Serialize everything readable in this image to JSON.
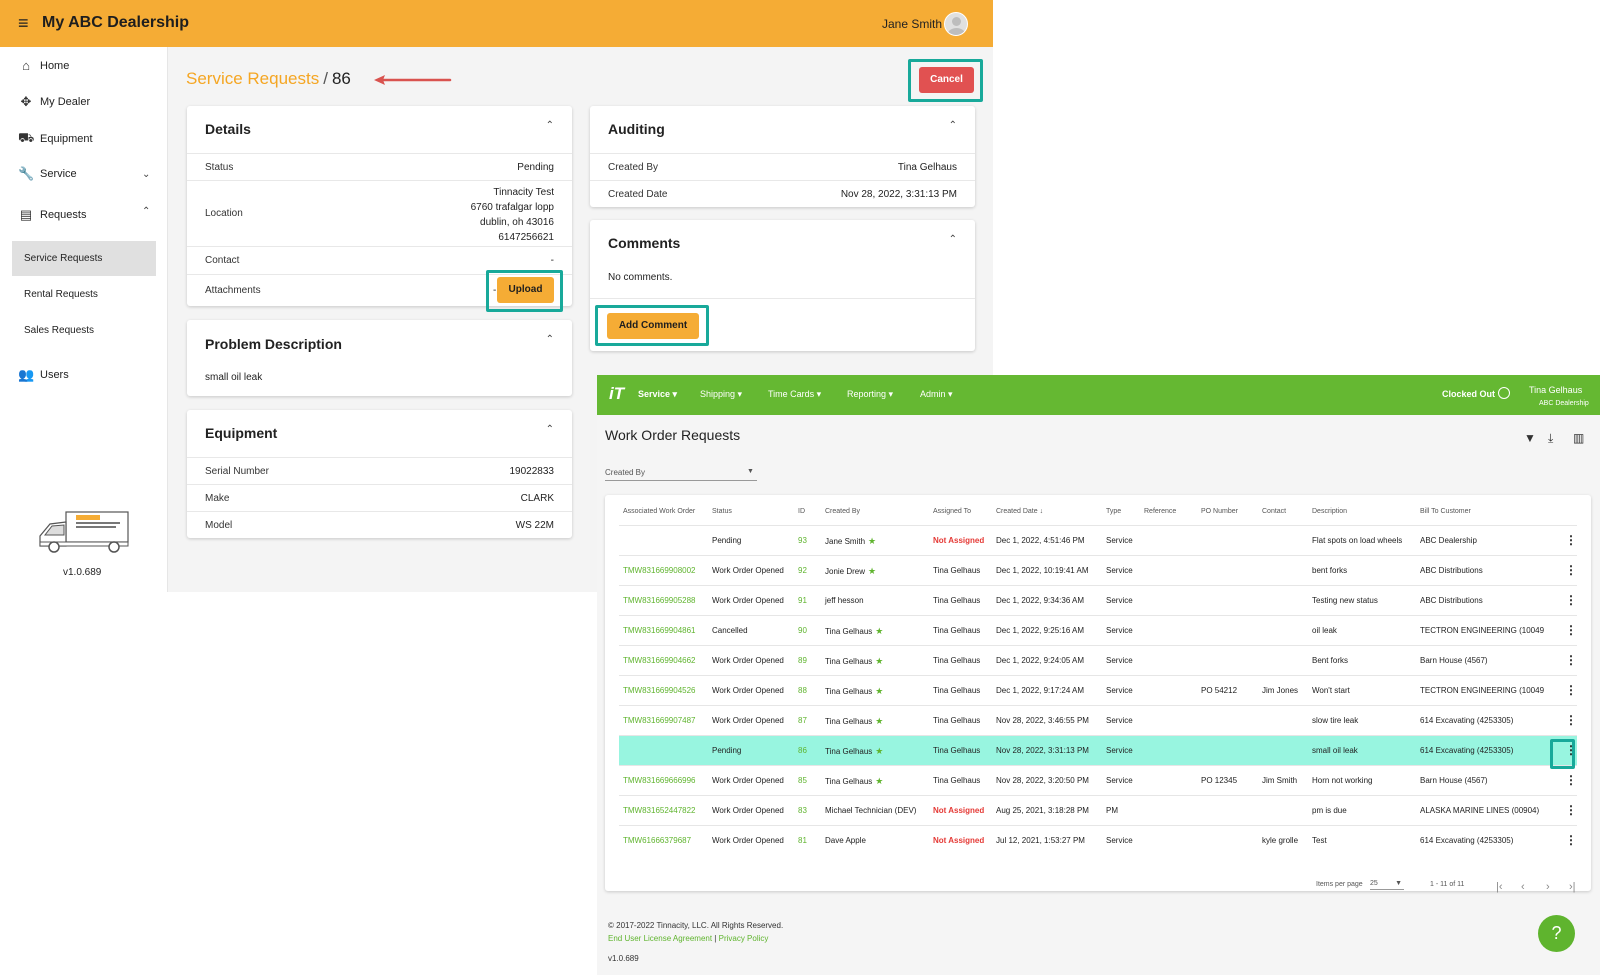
{
  "dealer": {
    "app_title": "My ABC Dealership",
    "user_name": "Jane Smith",
    "version": "v1.0.689",
    "sidebar": {
      "home": "Home",
      "my_dealer": "My Dealer",
      "equipment": "Equipment",
      "service": "Service",
      "requests": "Requests",
      "service_requests": "Service Requests",
      "rental_requests": "Rental Requests",
      "sales_requests": "Sales Requests",
      "users": "Users"
    },
    "breadcrumb": {
      "parent": "Service Requests",
      "separator": "/",
      "current": "86"
    },
    "cancel_label": "Cancel",
    "details": {
      "title": "Details",
      "status_label": "Status",
      "status_value": "Pending",
      "location_label": "Location",
      "location_lines": [
        "Tinnacity Test",
        "6760 trafalgar lopp",
        "dublin, oh 43016",
        "6147256621"
      ],
      "contact_label": "Contact",
      "contact_value": "-",
      "attachments_label": "Attachments",
      "attachments_value": "-",
      "upload_label": "Upload"
    },
    "problem": {
      "title": "Problem Description",
      "text": "small oil leak"
    },
    "equipment": {
      "title": "Equipment",
      "serial_label": "Serial Number",
      "serial_value": "19022833",
      "make_label": "Make",
      "make_value": "CLARK",
      "model_label": "Model",
      "model_value": "WS 22M"
    },
    "auditing": {
      "title": "Auditing",
      "created_by_label": "Created By",
      "created_by_value": "Tina Gelhaus",
      "created_date_label": "Created Date",
      "created_date_value": "Nov 28, 2022, 3:31:13 PM"
    },
    "comments": {
      "title": "Comments",
      "empty_text": "No comments.",
      "add_label": "Add Comment"
    }
  },
  "workorder": {
    "logo": "iT",
    "nav": [
      "Service ▾",
      "Shipping ▾",
      "Time Cards ▾",
      "Reporting ▾",
      "Admin ▾"
    ],
    "clock_status": "Clocked Out",
    "user_name": "Tina Gelhaus",
    "user_company": "ABC Dealership",
    "page_title": "Work Order Requests",
    "filter_label": "Created By",
    "columns": [
      "Associated Work Order",
      "Status",
      "ID",
      "Created By",
      "Assigned To",
      "Created Date",
      "Type",
      "Reference",
      "PO Number",
      "Contact",
      "Description",
      "Bill To Customer"
    ],
    "rows": [
      {
        "wo": "",
        "status": "Pending",
        "id": "93",
        "created_by": "Jane Smith",
        "star": true,
        "assigned": "Not Assigned",
        "date": "Dec 1, 2022, 4:51:46 PM",
        "type": "Service",
        "ref": "",
        "po": "",
        "contact": "",
        "desc": "Flat spots on load wheels",
        "bill": "ABC Dealership"
      },
      {
        "wo": "TMW831669908002",
        "status": "Work Order Opened",
        "id": "92",
        "created_by": "Jonie Drew",
        "star": true,
        "assigned": "Tina Gelhaus",
        "date": "Dec 1, 2022, 10:19:41 AM",
        "type": "Service",
        "ref": "",
        "po": "",
        "contact": "",
        "desc": "bent forks",
        "bill": "ABC Distributions"
      },
      {
        "wo": "TMW831669905288",
        "status": "Work Order Opened",
        "id": "91",
        "created_by": "jeff hesson",
        "star": false,
        "assigned": "Tina Gelhaus",
        "date": "Dec 1, 2022, 9:34:36 AM",
        "type": "Service",
        "ref": "",
        "po": "",
        "contact": "",
        "desc": "Testing new status",
        "bill": "ABC Distributions"
      },
      {
        "wo": "TMW831669904861",
        "status": "Cancelled",
        "id": "90",
        "created_by": "Tina Gelhaus",
        "star": true,
        "assigned": "Tina Gelhaus",
        "date": "Dec 1, 2022, 9:25:16 AM",
        "type": "Service",
        "ref": "",
        "po": "",
        "contact": "",
        "desc": "oil leak",
        "bill": "TECTRON ENGINEERING (10049"
      },
      {
        "wo": "TMW831669904662",
        "status": "Work Order Opened",
        "id": "89",
        "created_by": "Tina Gelhaus",
        "star": true,
        "assigned": "Tina Gelhaus",
        "date": "Dec 1, 2022, 9:24:05 AM",
        "type": "Service",
        "ref": "",
        "po": "",
        "contact": "",
        "desc": "Bent forks",
        "bill": "Barn House (4567)"
      },
      {
        "wo": "TMW831669904526",
        "status": "Work Order Opened",
        "id": "88",
        "created_by": "Tina Gelhaus",
        "star": true,
        "assigned": "Tina Gelhaus",
        "date": "Dec 1, 2022, 9:17:24 AM",
        "type": "Service",
        "ref": "",
        "po": "PO 54212",
        "contact": "Jim Jones",
        "desc": "Won't start",
        "bill": "TECTRON ENGINEERING (10049"
      },
      {
        "wo": "TMW831669907487",
        "status": "Work Order Opened",
        "id": "87",
        "created_by": "Tina Gelhaus",
        "star": true,
        "assigned": "Tina Gelhaus",
        "date": "Nov 28, 2022, 3:46:55 PM",
        "type": "Service",
        "ref": "",
        "po": "",
        "contact": "",
        "desc": "slow tire leak",
        "bill": "614 Excavating (4253305)"
      },
      {
        "wo": "",
        "status": "Pending",
        "id": "86",
        "created_by": "Tina Gelhaus",
        "star": true,
        "assigned": "Tina Gelhaus",
        "date": "Nov 28, 2022, 3:31:13 PM",
        "type": "Service",
        "ref": "",
        "po": "",
        "contact": "",
        "desc": "small oil leak",
        "bill": "614 Excavating (4253305)",
        "selected": true
      },
      {
        "wo": "TMW831669666996",
        "status": "Work Order Opened",
        "id": "85",
        "created_by": "Tina Gelhaus",
        "star": true,
        "assigned": "Tina Gelhaus",
        "date": "Nov 28, 2022, 3:20:50 PM",
        "type": "Service",
        "ref": "",
        "po": "PO 12345",
        "contact": "Jim Smith",
        "desc": "Horn not working",
        "bill": "Barn House (4567)"
      },
      {
        "wo": "TMW831652447822",
        "status": "Work Order Opened",
        "id": "83",
        "created_by": "Michael Technician (DEV)",
        "star": false,
        "assigned": "Not Assigned",
        "date": "Aug 25, 2021, 3:18:28 PM",
        "type": "PM",
        "ref": "",
        "po": "",
        "contact": "",
        "desc": "pm is due",
        "bill": "ALASKA MARINE LINES (00904)"
      },
      {
        "wo": "TMW61666379687",
        "status": "Work Order Opened",
        "id": "81",
        "created_by": "Dave Apple",
        "star": false,
        "assigned": "Not Assigned",
        "date": "Jul 12, 2021, 1:53:27 PM",
        "type": "Service",
        "ref": "",
        "po": "",
        "contact": "kyle grolle",
        "desc": "Test",
        "bill": "614 Excavating (4253305)"
      }
    ],
    "items_per_page_label": "Items per page",
    "items_per_page_value": "25",
    "range_text": "1 - 11 of 11",
    "footer_copyright": "© 2017-2022 Tinnacity, LLC. All Rights Reserved.",
    "footer_eula": "End User License Agreement",
    "footer_sep": "|",
    "footer_privacy": "Privacy Policy",
    "version": "v1.0.689",
    "help_label": "?"
  },
  "colors": {
    "dealer_accent": "#f5ac35",
    "cancel_red": "#e15151",
    "highlight_teal": "#18a99a",
    "wo_green": "#65b832",
    "selected_row": "#98f5e0"
  }
}
